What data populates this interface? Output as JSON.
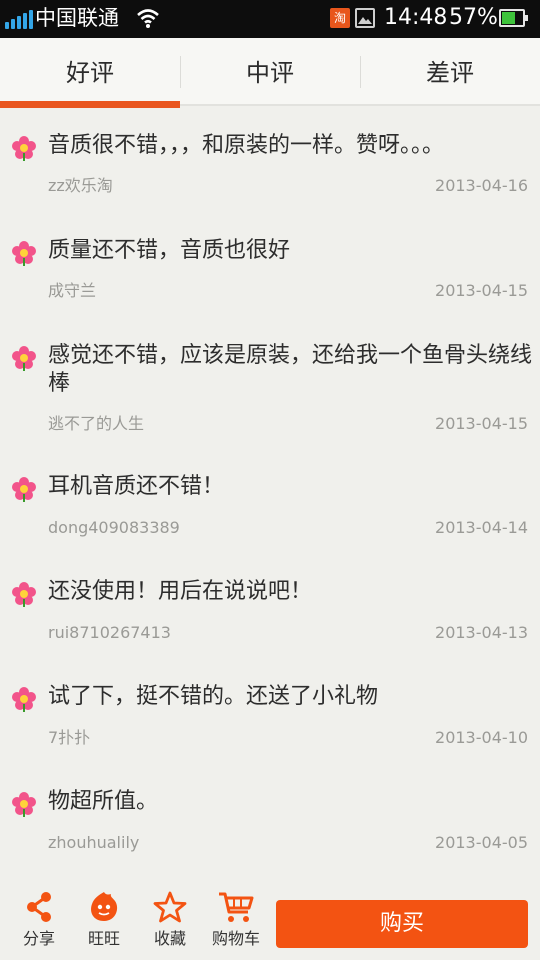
{
  "status_bar": {
    "carrier": "中国联通",
    "time": "14:48",
    "battery": "57%",
    "battery_level": 0.57,
    "app_icon_text": "淘",
    "icons": [
      "signal-icon",
      "wifi-icon",
      "taobao-notification-icon",
      "image-notification-icon",
      "battery-icon"
    ]
  },
  "tabs": [
    {
      "label": "好评",
      "selected": true
    },
    {
      "label": "中评",
      "selected": false
    },
    {
      "label": "差评",
      "selected": false
    }
  ],
  "accent_color": "#e9561f",
  "reviews": [
    {
      "text": "音质很不错，，，和原装的一样。赞呀。。。",
      "user": "zz欢乐淘",
      "date": "2013-04-16"
    },
    {
      "text": "质量还不错，音质也很好",
      "user": "成守兰",
      "date": "2013-04-15"
    },
    {
      "text": "感觉还不错，应该是原装，还给我一个鱼骨头绕线棒",
      "user": "逃不了的人生",
      "date": "2013-04-15"
    },
    {
      "text": "耳机音质还不错！",
      "user": "dong409083389",
      "date": "2013-04-14"
    },
    {
      "text": "还没使用！用后在说说吧！",
      "user": "rui8710267413",
      "date": "2013-04-13"
    },
    {
      "text": "试了下，挺不错的。还送了小礼物",
      "user": "7扑扑",
      "date": "2013-04-10"
    },
    {
      "text": "物超所值。",
      "user": "zhouhualily",
      "date": "2013-04-05"
    }
  ],
  "bottom_bar": {
    "share_label": "分享",
    "wangwang_label": "旺旺",
    "favorite_label": "收藏",
    "cart_label": "购物车",
    "buy_label": "购买",
    "buy_color": "#f35312"
  }
}
